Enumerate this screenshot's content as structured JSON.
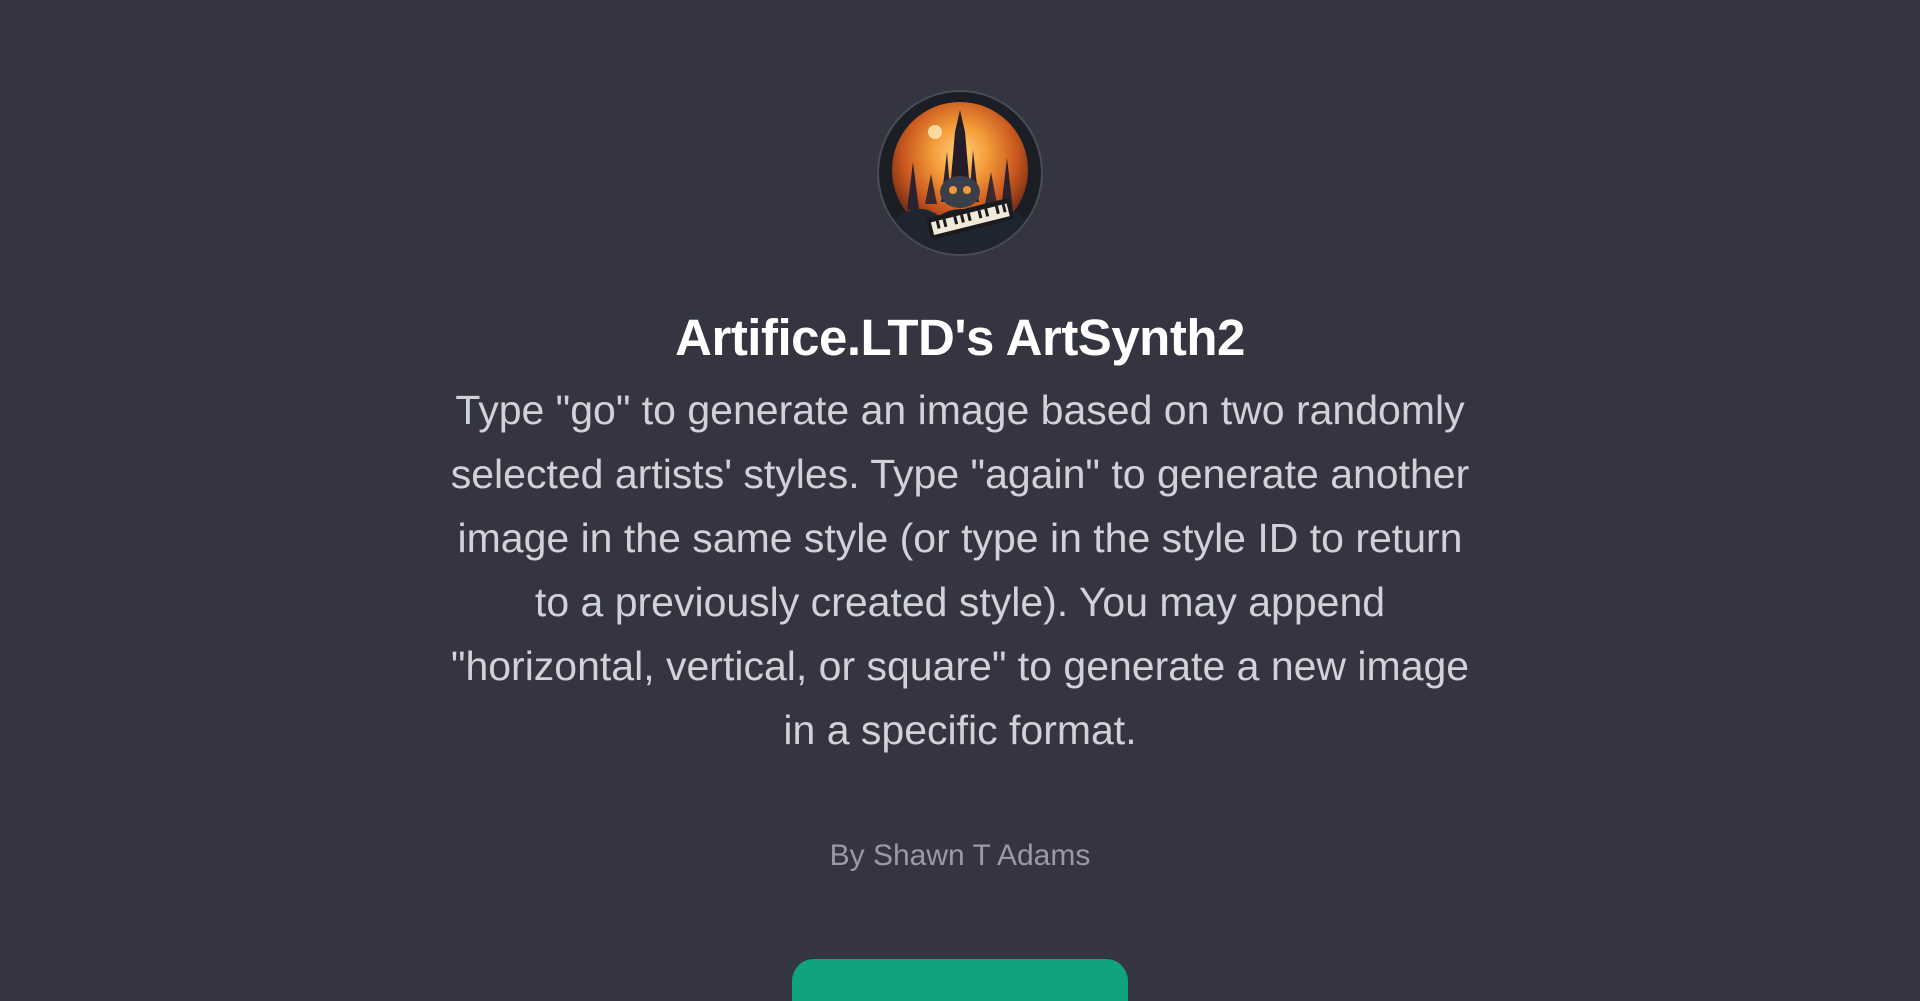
{
  "gpt": {
    "avatar_icon": "artsynth-keyboard-castle-logo",
    "name": "Artifice.LTD's ArtSynth2",
    "description": "Type \"go\" to generate an image based on two randomly selected artists' styles. Type \"again\" to generate another image in the same style (or type in the style ID to return to a previously created style). You may append \"horizontal, vertical, or square\" to generate a new image in a specific format.",
    "author": "By Shawn T Adams"
  },
  "cta": {
    "label": ""
  },
  "colors": {
    "background": "#343541",
    "title": "#ffffff",
    "description": "#d1d1da",
    "author": "#9a9aa6",
    "button": "#10a37f",
    "avatar_orange": "#f08a2a"
  }
}
